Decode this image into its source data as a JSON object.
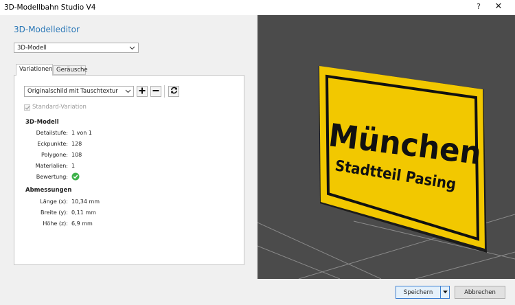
{
  "window": {
    "title": "3D-Modellbahn Studio V4",
    "help_label": "?",
    "close_label": "✕"
  },
  "editor": {
    "title": "3D-Modelleditor",
    "mode_select": {
      "selected": "3D-Modell"
    },
    "tabs": [
      {
        "label": "Variationen",
        "active": true
      },
      {
        "label": "Geräusche",
        "active": false
      }
    ],
    "variation_select": {
      "selected": "Originalschild mit Tauschtextur"
    },
    "toolbar": {
      "add_icon": "plus-icon",
      "remove_icon": "minus-icon",
      "refresh_icon": "refresh-icon"
    },
    "standard_variation": {
      "label": "Standard-Variation",
      "checked": true,
      "disabled": true
    },
    "model_section": {
      "heading": "3D-Modell",
      "rows": [
        {
          "label": "Detailstufe:",
          "value": "1 von 1"
        },
        {
          "label": "Eckpunkte:",
          "value": "128"
        },
        {
          "label": "Polygone:",
          "value": "108"
        },
        {
          "label": "Materialien:",
          "value": "1"
        },
        {
          "label": "Bewertung:",
          "value": "",
          "icon": "check-circle-icon",
          "color": "#3db24a"
        }
      ]
    },
    "dimensions_section": {
      "heading": "Abmessungen",
      "rows": [
        {
          "label": "Länge (x):",
          "value": "10,34 mm"
        },
        {
          "label": "Breite (y):",
          "value": "0,11 mm"
        },
        {
          "label": "Höhe (z):",
          "value": "6,9 mm"
        }
      ]
    }
  },
  "viewport": {
    "sign_line1": "München",
    "sign_line2": "Stadtteil Pasing",
    "sign_color": "#f2c800",
    "background_color": "#4b4b4b"
  },
  "footer": {
    "save_label": "Speichern",
    "cancel_label": "Abbrechen"
  }
}
